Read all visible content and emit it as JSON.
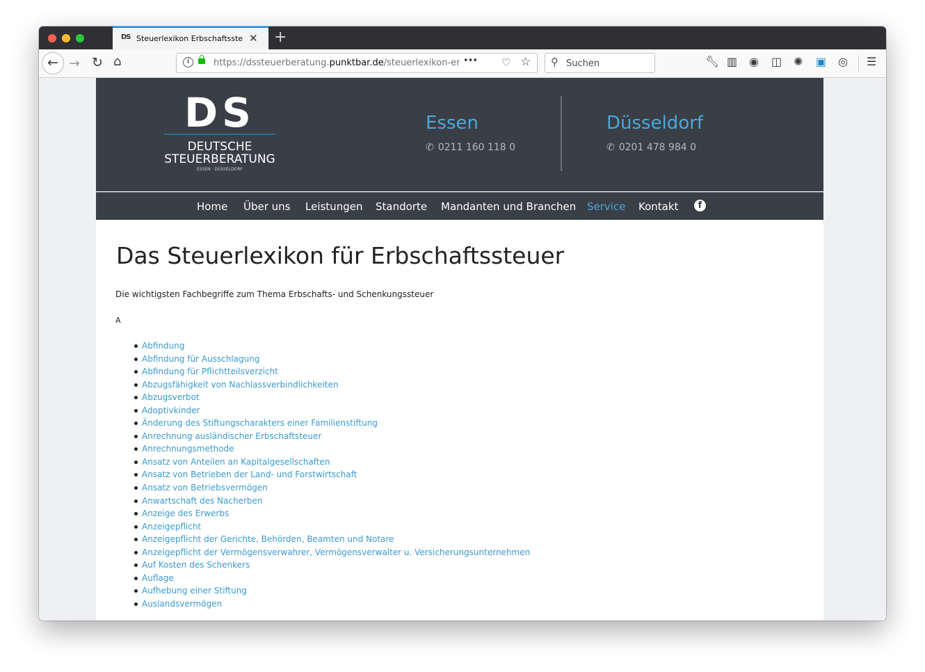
{
  "browser": {
    "tab_title": "Steuerlexikon Erbschaftssteuer",
    "tab_favicon": "DS",
    "new_tab_label": "+",
    "url_prefix": "https://dssteuerberatung.",
    "url_domain": "punktbar.de",
    "url_path": "/steuerlexikon-erbschafts",
    "search_placeholder": "Suchen",
    "icons": [
      "back-icon",
      "forward-icon",
      "reload-icon",
      "home-icon",
      "info-icon",
      "lock-icon",
      "page-actions-icon",
      "pocket-icon",
      "bookmark-star-icon",
      "search-icon",
      "wrench-icon",
      "library-icon",
      "extension-icon",
      "sidebar-icon",
      "addon-icon",
      "screenshot-icon",
      "account-icon",
      "menu-icon"
    ]
  },
  "site": {
    "logo": {
      "mark": "DS",
      "line1": "DEUTSCHE",
      "line2": "STEUERBERATUNG",
      "small": "ESSEN  ·  DÜSSELDORF"
    },
    "locations": [
      {
        "city": "Essen",
        "phone": "0211 160 118 0"
      },
      {
        "city": "Düsseldorf",
        "phone": "0201 478 984 0"
      }
    ],
    "nav": [
      {
        "label": "Home",
        "active": false
      },
      {
        "label": "Über uns",
        "active": false
      },
      {
        "label": "Leistungen",
        "active": false
      },
      {
        "label": "Standorte",
        "active": false
      },
      {
        "label": "Mandanten und Branchen",
        "active": false
      },
      {
        "label": "Service",
        "active": true
      },
      {
        "label": "Kontakt",
        "active": false
      }
    ],
    "colors": {
      "header_bg": "#3a3e46",
      "accent": "#49a9d9",
      "link": "#3a9ad3"
    }
  },
  "content": {
    "title": "Das Steuerlexikon für Erbschaftssteuer",
    "intro": "Die wichtigsten Fachbegriffe zum Thema Erbschafts- und Schenkungssteuer",
    "letter": "A",
    "terms": [
      "Abfindung",
      "Abfindung für Ausschlagung",
      "Abfindung für Pflichtteilsverzicht",
      "Abzugsfähigkeit von Nachlassverbindlichkeiten",
      "Abzugsverbot",
      "Adoptivkinder",
      "Änderung des Stiftungscharakters einer Familienstiftung",
      "Anrechnung ausländischer Erbschaftsteuer",
      "Anrechnungsmethode",
      "Ansatz von Anteilen an Kapitalgesellschaften",
      "Ansatz von Betrieben der Land- und Forstwirtschaft",
      "Ansatz von Betriebsvermögen",
      "Anwartschaft des Nacherben",
      "Anzeige des Erwerbs",
      "Anzeigepflicht",
      "Anzeigepflicht der Gerichte, Behörden, Beamten und Notare",
      "Anzeigepflicht der Vermögensverwahrer, Vermögensverwalter u. Versicherungsunternehmen",
      "Auf Kosten des Schenkers",
      "Auflage",
      "Aufhebung einer Stiftung",
      "Auslandsvermögen"
    ]
  }
}
